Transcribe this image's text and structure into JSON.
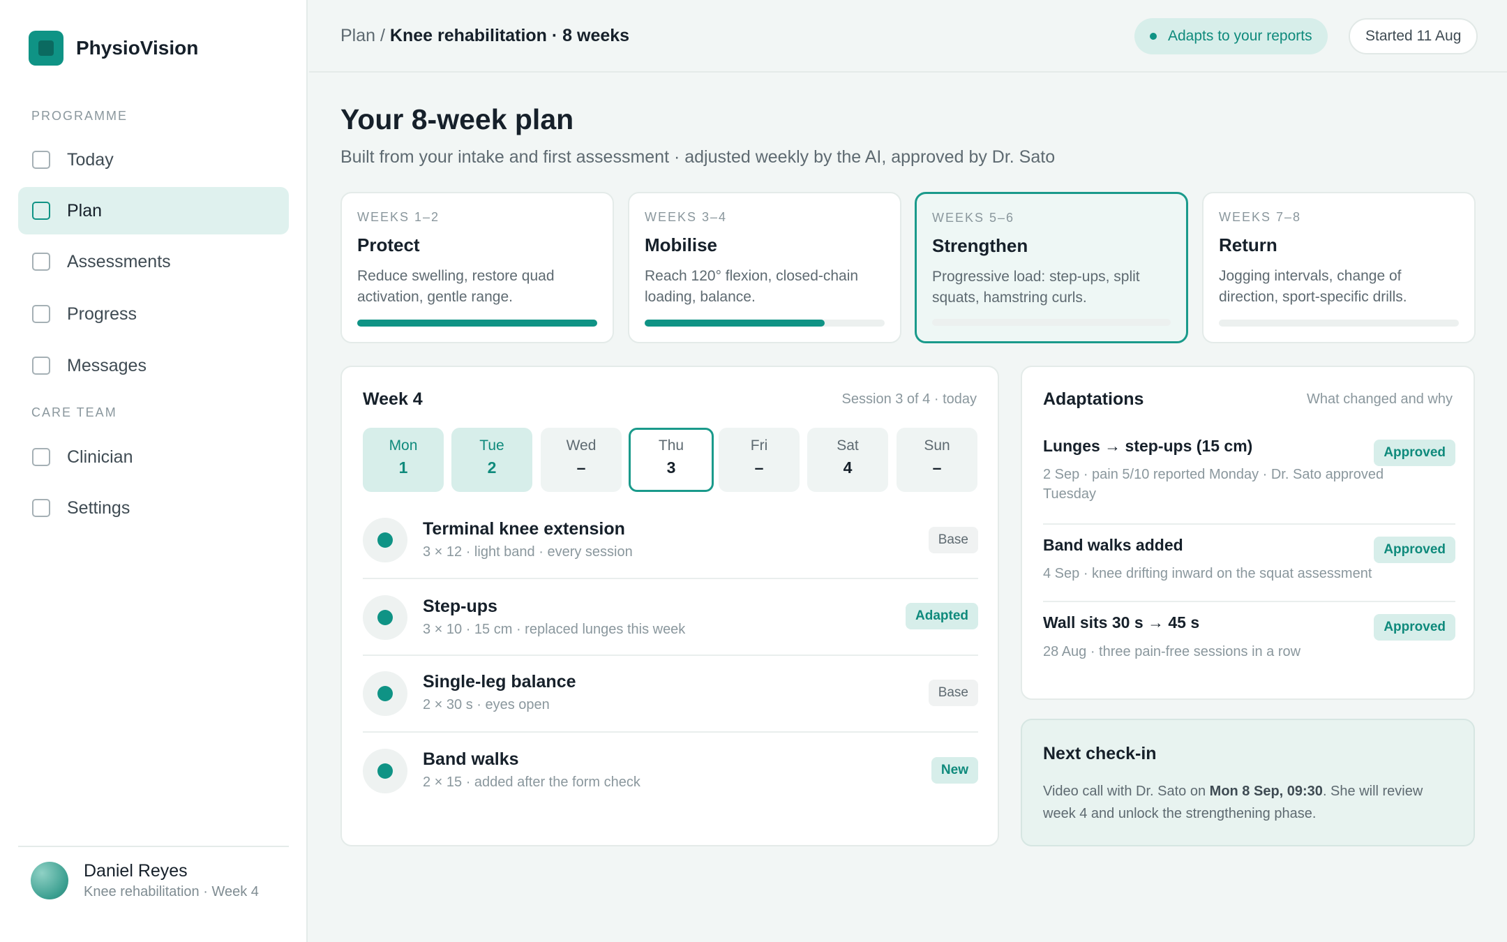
{
  "app": {
    "name": "PhysioVision"
  },
  "sidebar": {
    "section_programme": "PROGRAMME",
    "section_care": "CARE TEAM",
    "items": [
      {
        "label": "Today"
      },
      {
        "label": "Plan"
      },
      {
        "label": "Assessments"
      },
      {
        "label": "Progress"
      },
      {
        "label": "Messages"
      },
      {
        "label": "Clinician"
      },
      {
        "label": "Settings"
      }
    ],
    "active": "Plan",
    "user": {
      "name": "Daniel Reyes",
      "subtitle": "Knee rehabilitation · Week 4"
    }
  },
  "header": {
    "breadcrumb_root": "Plan",
    "breadcrumb_sep": " / ",
    "breadcrumb_current": "Knee rehabilitation · 8 weeks",
    "adapt_pill": "Adapts to your reports",
    "started_pill": "Started 11 Aug"
  },
  "main": {
    "title": "Your 8-week plan",
    "subtitle": "Built from your intake and first assessment · adjusted weekly by the AI, approved by Dr. Sato",
    "phases": [
      {
        "weeks": "WEEKS 1–2",
        "name": "Protect",
        "desc": "Reduce swelling, restore quad activation, gentle range.",
        "progress": 1.0
      },
      {
        "weeks": "WEEKS 3–4",
        "name": "Mobilise",
        "desc": "Reach 120° flexion, closed-chain loading, balance.",
        "progress": 0.75
      },
      {
        "weeks": "WEEKS 5–6",
        "name": "Strengthen",
        "desc": "Progressive load: step-ups, split squats, hamstring curls.",
        "progress": 0.0
      },
      {
        "weeks": "WEEKS 7–8",
        "name": "Return",
        "desc": "Jogging intervals, change of direction, sport-specific drills.",
        "progress": 0.0
      }
    ],
    "week": {
      "title": "Week 4",
      "meta": "Session 3 of 4 · today",
      "days": [
        {
          "name": "Mon",
          "value": "1"
        },
        {
          "name": "Tue",
          "value": "2"
        },
        {
          "name": "Wed",
          "value": "–"
        },
        {
          "name": "Thu",
          "value": "3"
        },
        {
          "name": "Fri",
          "value": "–"
        },
        {
          "name": "Sat",
          "value": "4"
        },
        {
          "name": "Sun",
          "value": "–"
        }
      ],
      "exercises": [
        {
          "name": "Terminal knee extension",
          "detail": "3 × 12 · light band · every session",
          "badge": "Base"
        },
        {
          "name": "Step-ups",
          "detail": "3 × 10 · 15 cm · replaced lunges this week",
          "badge": "Adapted"
        },
        {
          "name": "Single-leg balance",
          "detail": "2 × 30 s · eyes open",
          "badge": "Base"
        },
        {
          "name": "Band walks",
          "detail": "2 × 15 · added after the form check",
          "badge": "New"
        }
      ]
    },
    "adaptations": {
      "title": "Adaptations",
      "meta": "What changed and why",
      "items": [
        {
          "title": "Lunges → step-ups (15 cm)",
          "desc": "2 Sep · pain 5/10 reported Monday · Dr. Sato approved Tuesday",
          "status": "Approved"
        },
        {
          "title": "Band walks added",
          "desc": "4 Sep · knee drifting inward on the squat assessment",
          "status": "Approved"
        },
        {
          "title": "Wall sits 30 s → 45 s",
          "desc": "28 Aug · three pain-free sessions in a row",
          "status": "Approved"
        }
      ]
    },
    "checkin": {
      "title": "Next check-in",
      "text_before": "Video call with Dr. Sato on ",
      "text_bold": "Mon 8 Sep, 09:30",
      "text_after": ". She will review week 4 and unlock the strengthening phase."
    }
  }
}
